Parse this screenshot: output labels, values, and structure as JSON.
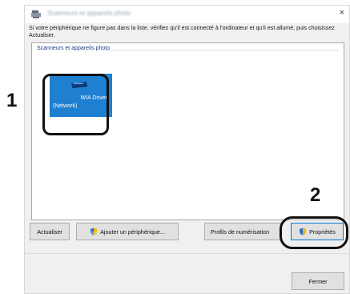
{
  "window": {
    "title": "Scanneurs et appareils photo",
    "close_glyph": "×"
  },
  "instructions": "Si votre périphérique ne figure pas dans la liste, vérifiez qu'il est connecté à l'ordinateur et qu'il est allumé, puis choisissez Actualiser.",
  "list": {
    "group_label": "Scanneurs et appareils photo",
    "devices": [
      {
        "name": "WIA Driver",
        "subtitle": "(Network)",
        "icon": "scanner-icon"
      }
    ]
  },
  "buttons": {
    "refresh": "Actualiser",
    "add_device": "Ajouter un périphérique...",
    "scan_profiles": "Profils de numérisation",
    "properties": "Propriétés",
    "close": "Fermer"
  },
  "callouts": {
    "step_1": "1",
    "step_2": "2"
  },
  "colors": {
    "tile_selected": "#1f7fd0",
    "group_label": "#1e3a8a",
    "default_button_border": "#0078d7"
  }
}
